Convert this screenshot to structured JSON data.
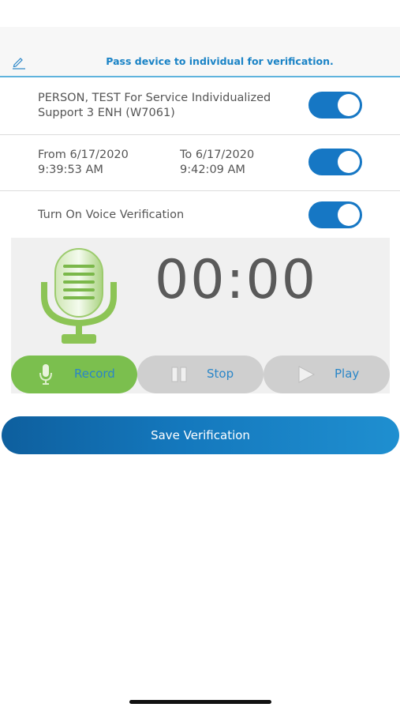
{
  "header": {
    "title": "Pass device to individual for verification.",
    "edit_icon": "pencil-icon"
  },
  "service_row": {
    "line1": "PERSON, TEST For Service Individualized",
    "line2": "Support 3 ENH (W7061)",
    "toggle_on": true
  },
  "time_row": {
    "from_date": "From 6/17/2020",
    "from_time": "9:39:53 AM",
    "to_date": "To 6/17/2020",
    "to_time": "9:42:09 AM",
    "toggle_on": true
  },
  "voice_row": {
    "label": "Turn On Voice Verification",
    "toggle_on": true
  },
  "recorder": {
    "timer": "00:00",
    "record_label": "Record",
    "stop_label": "Stop",
    "play_label": "Play",
    "mic_icon": "microphone-icon"
  },
  "save_button": {
    "label": "Save Verification"
  },
  "colors": {
    "accent_blue": "#1677c4",
    "record_green": "#7bbf4e",
    "label_blue": "#2a86c8"
  }
}
